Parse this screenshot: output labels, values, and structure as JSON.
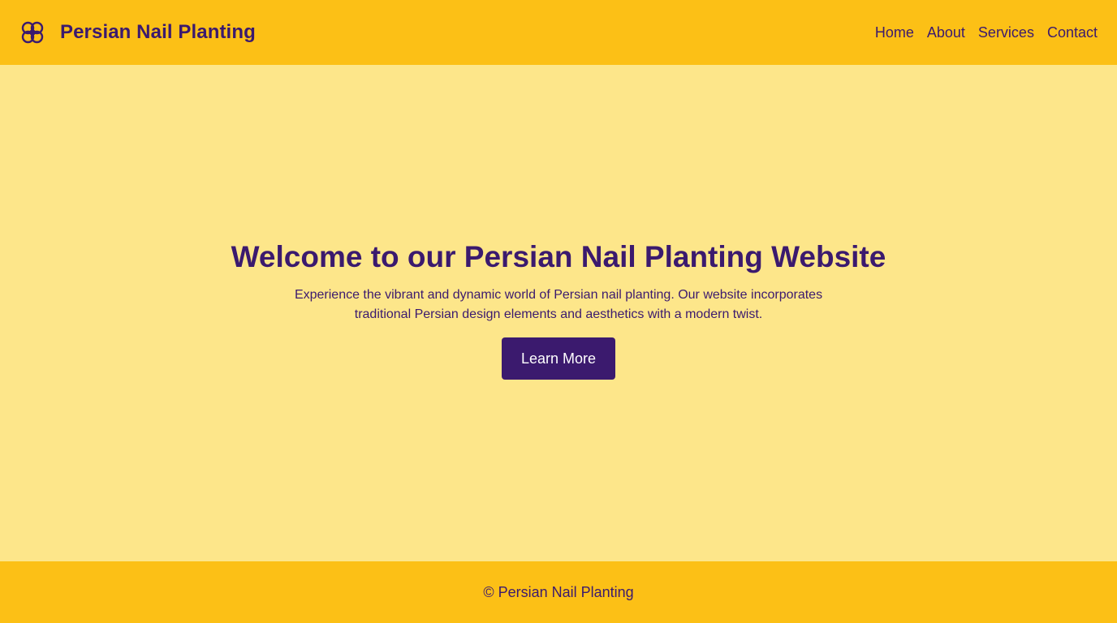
{
  "header": {
    "logo_icon": "flower-knot-icon",
    "title": "Persian Nail Planting",
    "nav": {
      "home": "Home",
      "about": "About",
      "services": "Services",
      "contact": "Contact"
    }
  },
  "hero": {
    "title": "Welcome to our Persian Nail Planting Website",
    "text": "Experience the vibrant and dynamic world of Persian nail planting. Our website incorporates traditional Persian design elements and aesthetics with a modern twist.",
    "cta_label": "Learn More"
  },
  "footer": {
    "text": "© Persian Nail Planting"
  },
  "colors": {
    "header_bg": "#fcc016",
    "page_bg": "#fde68a",
    "primary": "#3b1a6e",
    "button_text": "#ffffff"
  }
}
